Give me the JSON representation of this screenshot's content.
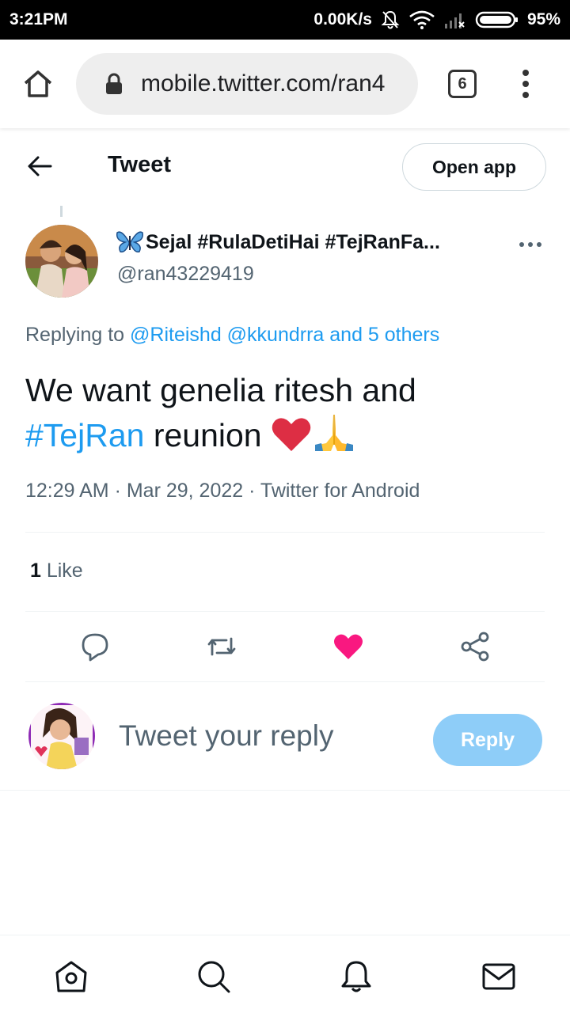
{
  "status_bar": {
    "time": "3:21PM",
    "network_speed": "0.00K/s",
    "battery_percent": "95%"
  },
  "browser": {
    "url": "mobile.twitter.com/ran4",
    "tab_count": "6"
  },
  "header": {
    "title": "Tweet",
    "open_app_label": "Open app"
  },
  "tweet": {
    "author_name": "Sejal #RulaDetiHai #TejRanFa...",
    "author_handle": "@ran43229419",
    "replying_prefix": "Replying to ",
    "replying_to": "@Riteishd @kkundrra and 5 others",
    "text_line1": "We want genelia ritesh and",
    "hashtag": "#TejRan",
    "text_line2_rest": " reunion ",
    "timestamp": "12:29 AM · Mar 29, 2022 · Twitter for Android",
    "like_count": "1",
    "like_label": " Like"
  },
  "composer": {
    "placeholder": "Tweet your reply",
    "reply_label": "Reply"
  },
  "colors": {
    "link_blue": "#1d9bf0",
    "like_pink": "#f91880",
    "reply_disabled": "#8ecdf8",
    "secondary_text": "#536471"
  },
  "icons": {
    "status": [
      "notifications-off-icon",
      "wifi-icon",
      "cell-signal-icon",
      "battery-icon"
    ],
    "browser": [
      "home-icon",
      "lock-icon",
      "tabs-icon",
      "overflow-menu-icon"
    ],
    "actions": [
      "reply-icon",
      "retweet-icon",
      "like-icon",
      "share-icon"
    ],
    "nav": [
      "home-nav-icon",
      "search-nav-icon",
      "notifications-nav-icon",
      "messages-nav-icon"
    ]
  }
}
